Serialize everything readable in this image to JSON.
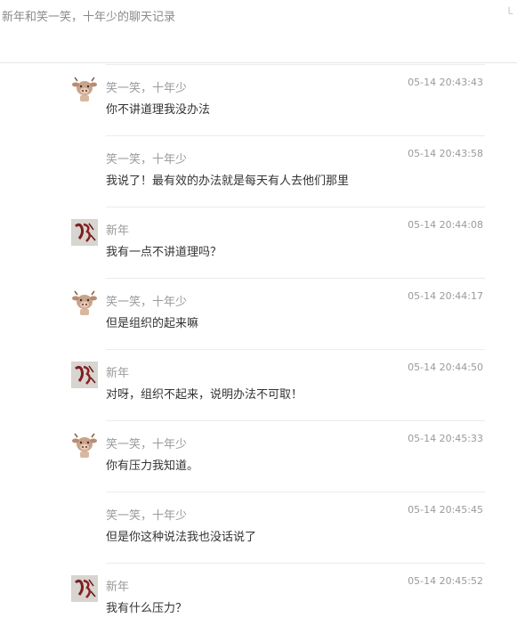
{
  "header": {
    "title": "新年和笑一笑，十年少的聊天记录",
    "corner_glyph": "㇄"
  },
  "messages": [
    {
      "sender": "笑一笑，十年少",
      "time": "05-14 20:43:43",
      "text": "你不讲道理我没办法",
      "avatar": "cow-avatar"
    },
    {
      "sender": "笑一笑，十年少",
      "time": "05-14 20:43:58",
      "text": "我说了！最有效的办法就是每天有人去他们那里",
      "avatar": "none"
    },
    {
      "sender": "新年",
      "time": "05-14 20:44:08",
      "text": "我有一点不讲道理吗？",
      "avatar": "calligraphy-avatar"
    },
    {
      "sender": "笑一笑，十年少",
      "time": "05-14 20:44:17",
      "text": "但是组织的起来嘛",
      "avatar": "cow-avatar"
    },
    {
      "sender": "新年",
      "time": "05-14 20:44:50",
      "text": "对呀，组织不起来，说明办法不可取！",
      "avatar": "calligraphy-avatar"
    },
    {
      "sender": "笑一笑，十年少",
      "time": "05-14 20:45:33",
      "text": "你有压力我知道。",
      "avatar": "cow-avatar"
    },
    {
      "sender": "笑一笑，十年少",
      "time": "05-14 20:45:45",
      "text": "但是你这种说法我也没话说了",
      "avatar": "none"
    },
    {
      "sender": "新年",
      "time": "05-14 20:45:52",
      "text": "我有什么压力？",
      "avatar": "calligraphy-avatar"
    }
  ]
}
